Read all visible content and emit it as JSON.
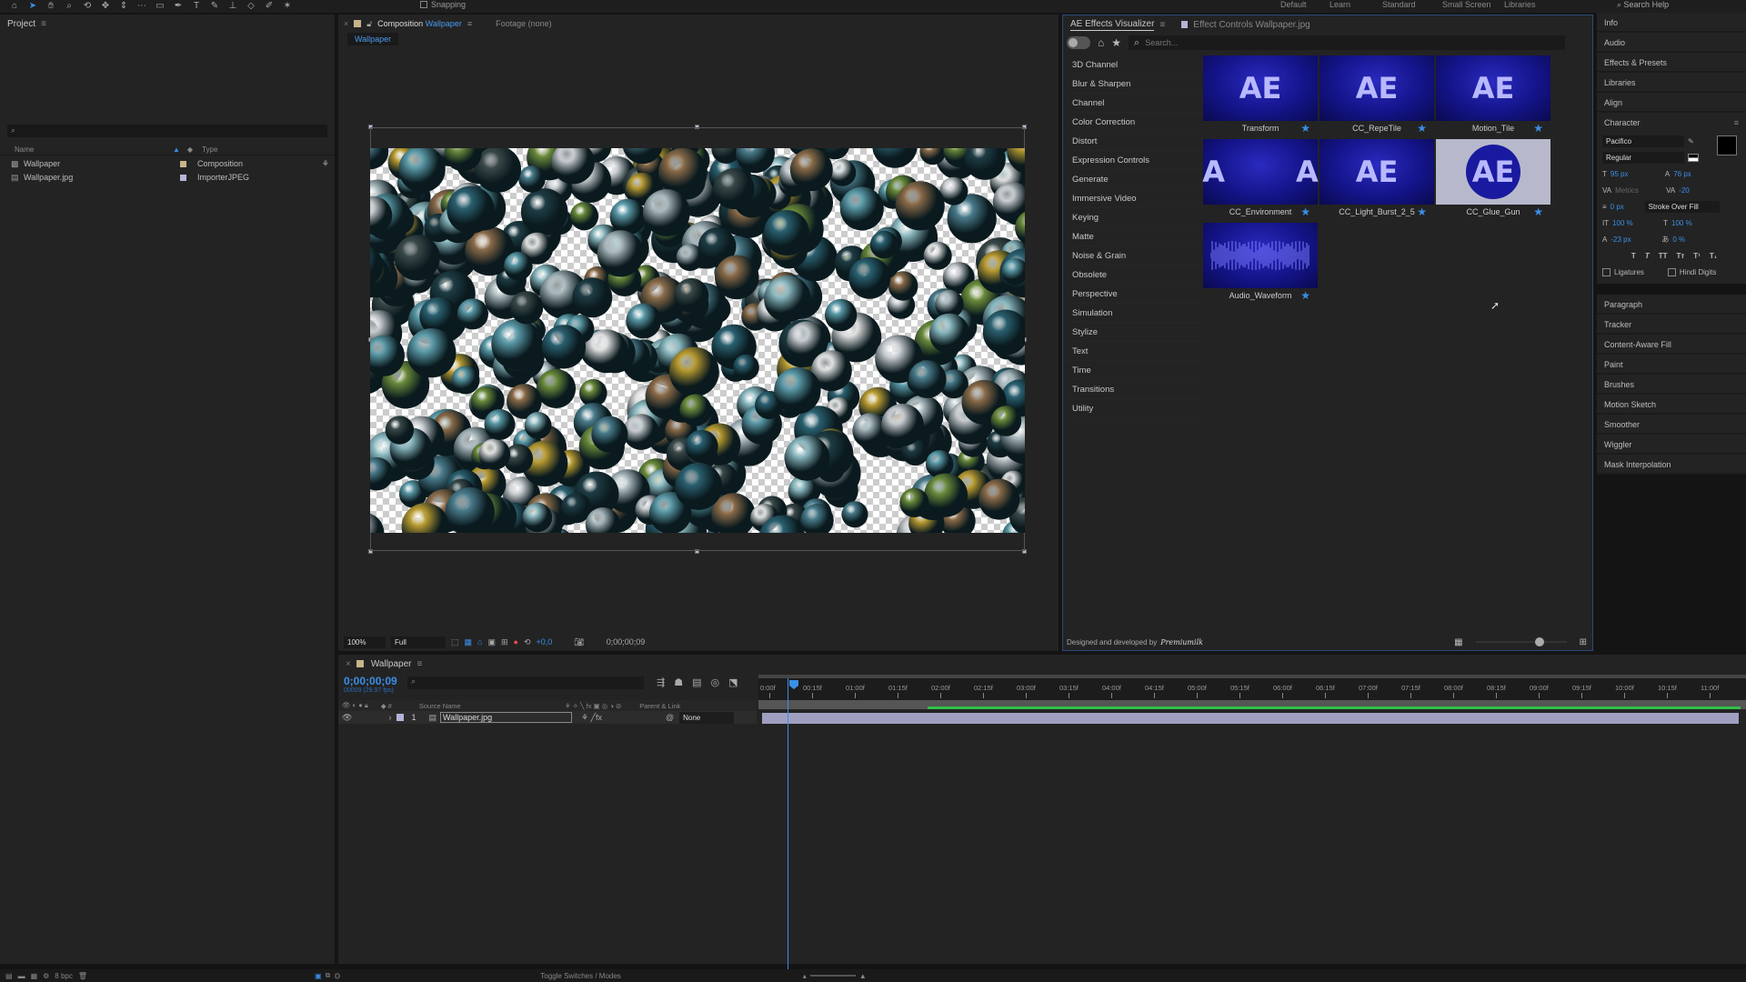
{
  "toolbar": {
    "tools": [
      "home-icon",
      "selection-icon",
      "hand-icon",
      "zoom-icon",
      "orbit-icon",
      "pan-icon",
      "dolly-icon",
      "pan-behind-icon",
      "rectangle-icon",
      "pen-icon",
      "type-icon",
      "brush-icon",
      "clone-stamp-icon",
      "eraser-icon",
      "roto-brush-icon",
      "puppet-icon"
    ],
    "snapping_label": "Snapping",
    "workspaces": [
      "Default",
      "Learn",
      "Standard",
      "Small Screen",
      "Libraries"
    ],
    "search_help": "Search Help"
  },
  "project": {
    "title": "Project",
    "columns": {
      "name": "Name",
      "type": "Type"
    },
    "items": [
      {
        "name": "Wallpaper",
        "type": "Composition",
        "label_color": "#c8b48a"
      },
      {
        "name": "Wallpaper.jpg",
        "type": "ImporterJPEG",
        "label_color": "#b4b4d8"
      }
    ],
    "bpc": "8 bpc"
  },
  "composition": {
    "tab_prefix": "Composition",
    "tab_name": "Wallpaper",
    "footage_tab": "Footage (none)",
    "sub_tab": "Wallpaper",
    "zoom": "100%",
    "resolution": "Full",
    "exposure": "+0,0",
    "timecode": "0;00;00;09"
  },
  "effects_visualizer": {
    "tab_label": "AE Effects Visualizer",
    "effect_controls_tab": "Effect Controls Wallpaper.jpg",
    "search_placeholder": "Search...",
    "categories": [
      "3D Channel",
      "Blur & Sharpen",
      "Channel",
      "Color Correction",
      "Distort",
      "Expression Controls",
      "Generate",
      "Immersive Video",
      "Keying",
      "Matte",
      "Noise & Grain",
      "Obsolete",
      "Perspective",
      "Simulation",
      "Stylize",
      "Text",
      "Time",
      "Transitions",
      "Utility"
    ],
    "effects": [
      {
        "name": "Transform",
        "thumb": "AE",
        "favorite": true
      },
      {
        "name": "CC_RepeTile",
        "thumb": "AE",
        "favorite": true
      },
      {
        "name": "Motion_Tile",
        "thumb": "AE",
        "favorite": true
      },
      {
        "name": "CC_Environment",
        "thumb": "A       A",
        "favorite": true
      },
      {
        "name": "CC_Light_Burst_2_5",
        "thumb": "AE",
        "favorite": true
      },
      {
        "name": "CC_Glue_Gun",
        "thumb": "AE",
        "favorite": true
      },
      {
        "name": "Audio_Waveform",
        "thumb": "",
        "favorite": true
      }
    ],
    "footer_text": "Designed and developed by",
    "footer_brand": "Premiumilk",
    "thumb_size": 0.7
  },
  "right_panels": {
    "top": [
      "Info",
      "Audio",
      "Effects & Presets",
      "Libraries",
      "Align"
    ],
    "character": {
      "title": "Character",
      "font": "Pacifico",
      "style": "Regular",
      "size": "95 px",
      "leading": "76 px",
      "kerning": "Metrics",
      "tracking": "-20",
      "stroke_width": "0 px",
      "stroke_mode": "Stroke Over Fill",
      "vert_scale": "100 %",
      "horiz_scale": "100 %",
      "baseline_shift": "-23 px",
      "tsume": "0 %",
      "ligatures": "Ligatures",
      "hindi_digits": "Hindi Digits"
    },
    "bottom": [
      "Paragraph",
      "Tracker",
      "Content-Aware Fill",
      "Paint",
      "Brushes",
      "Motion Sketch",
      "Smoother",
      "Wiggler",
      "Mask Interpolation"
    ]
  },
  "timeline": {
    "tab": "Wallpaper",
    "timecode": "0;00;00;09",
    "fps_note": "00009 (29.97 fps)",
    "columns": {
      "source_name": "Source Name",
      "parent": "Parent & Link"
    },
    "layer": {
      "index": "1",
      "name": "Wallpaper.jpg",
      "parent": "None"
    },
    "ruler": [
      "0:00f",
      "00:15f",
      "01:00f",
      "01:15f",
      "02:00f",
      "02:15f",
      "03:00f",
      "03:15f",
      "04:00f",
      "04:15f",
      "05:00f",
      "05:15f",
      "06:00f",
      "06:15f",
      "07:00f",
      "07:15f",
      "08:00f",
      "08:15f",
      "09:00f",
      "09:15f",
      "10:00f",
      "10:15f",
      "11:00f"
    ],
    "toggle_label": "Toggle Switches / Modes"
  }
}
